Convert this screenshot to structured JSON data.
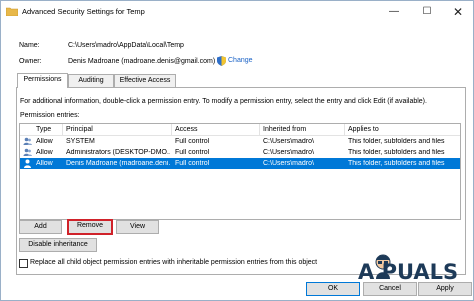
{
  "window": {
    "title": "Advanced Security Settings for Temp",
    "min_symbol": "—",
    "max_symbol": "☐",
    "close_symbol": "✕"
  },
  "info": {
    "name_label": "Name:",
    "name_value": "C:\\Users\\madro\\AppData\\Local\\Temp",
    "owner_label": "Owner:",
    "owner_value": "Denis Madroane (madroane.denis@gmail.com)",
    "change_link": "Change"
  },
  "tabs": [
    {
      "label": "Permissions",
      "active": true
    },
    {
      "label": "Auditing",
      "active": false
    },
    {
      "label": "Effective Access",
      "active": false
    }
  ],
  "panel": {
    "instructions": "For additional information, double-click a permission entry. To modify a permission entry, select the entry and click Edit (if available).",
    "entries_label": "Permission entries:"
  },
  "table": {
    "headers": [
      "Type",
      "Principal",
      "Access",
      "Inherited from",
      "Applies to"
    ],
    "rows": [
      {
        "type": "Allow",
        "principal": "SYSTEM",
        "access": "Full control",
        "inherited": "C:\\Users\\madro\\",
        "applies": "This folder, subfolders and files",
        "selected": false
      },
      {
        "type": "Allow",
        "principal": "Administrators (DESKTOP-DMO...",
        "access": "Full control",
        "inherited": "C:\\Users\\madro\\",
        "applies": "This folder, subfolders and files",
        "selected": false
      },
      {
        "type": "Allow",
        "principal": "Denis Madroane (madroane.deni...",
        "access": "Full control",
        "inherited": "C:\\Users\\madro\\",
        "applies": "This folder, subfolders and files",
        "selected": true
      }
    ]
  },
  "buttons": {
    "add": "Add",
    "remove": "Remove",
    "view": "View",
    "disable_inheritance": "Disable inheritance",
    "ok": "OK",
    "cancel": "Cancel",
    "apply": "Apply"
  },
  "replace_checkbox": {
    "label": "Replace all child object permission entries with inheritable permission entries from this object",
    "checked": false
  },
  "watermark": {
    "text": "A PUALS"
  },
  "colors": {
    "selection": "#0078d7",
    "highlight_border": "#d0222a",
    "link": "#1a62c6"
  }
}
